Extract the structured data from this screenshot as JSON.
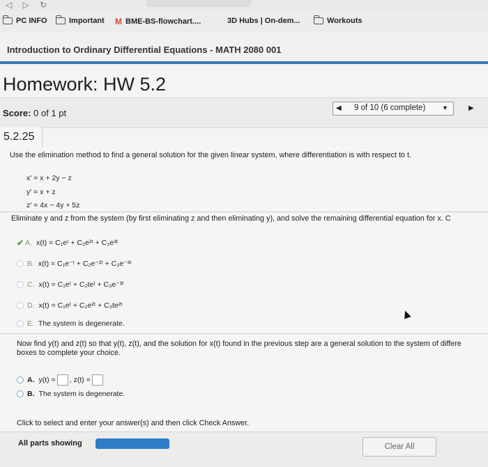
{
  "bookmarks": [
    {
      "label": "PC INFO",
      "icon": "folder-icon"
    },
    {
      "label": "Important",
      "icon": "folder-icon"
    },
    {
      "label": "BME-BS-flowchart....",
      "icon": "m-logo-icon"
    },
    {
      "label": "3D Hubs | On-dem..."
    },
    {
      "label": "Workouts",
      "icon": "folder-icon"
    }
  ],
  "course_title": "Introduction to Ordinary Differential Equations - MATH 2080 001",
  "homework_title": "Homework: HW 5.2",
  "score": {
    "label": "Score:",
    "value": "0 of 1 pt"
  },
  "pager": {
    "text": "9 of 10 (6 complete)"
  },
  "question_number": "5.2.25",
  "prompt": "Use the elimination method to find a general solution for the given linear system, where differentiation is with respect to t.",
  "equations": [
    "x′ = x + 2y − z",
    "y′ = x + z",
    "z′ = 4x − 4y + 5z"
  ],
  "eliminate_instruction": "Eliminate y and z from the system (by first eliminating z and then eliminating y), and solve the remaining differential equation for x. C",
  "options_part1": [
    {
      "letter": "A.",
      "text": "x(t) = C₁eᵗ + C₂e²ᵗ + C₃e³ᵗ",
      "selected": true
    },
    {
      "letter": "B.",
      "text": "x(t) = C₁e⁻ᵗ + C₂e⁻²ᵗ + C₃e⁻³ᵗ"
    },
    {
      "letter": "C.",
      "text": "x(t) = C₁eᵗ + C₂teᵗ + C₃e⁻³ᵗ"
    },
    {
      "letter": "D.",
      "text": "x(t) = C₁eᵗ + C₂e²ᵗ + C₃te²ᵗ"
    },
    {
      "letter": "E.",
      "text": "The system is degenerate."
    }
  ],
  "now_find": {
    "line1": "Now find y(t) and z(t) so that y(t), z(t), and the solution for x(t) found in the previous step are a general solution to the system of differe",
    "line2": "boxes to complete your choice."
  },
  "options_part2": [
    {
      "letter": "A.",
      "y_label": "y(t) =",
      "z_label": "z(t) ="
    },
    {
      "letter": "B.",
      "text": "The system is degenerate."
    }
  ],
  "click_instruction": "Click to select and enter your answer(s) and then click Check Answer.",
  "footer": {
    "parts_label": "All parts showing",
    "progress": 1.0,
    "clear_label": "Clear All"
  },
  "colors": {
    "accent": "#3a79bd",
    "progress": "#2f7cc7",
    "check": "#4aa040"
  }
}
